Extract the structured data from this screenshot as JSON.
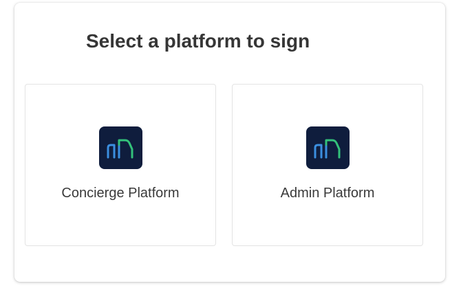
{
  "heading": "Select a platform to sign",
  "platforms": [
    {
      "label": "Concierge Platform",
      "icon": "building-logo-icon"
    },
    {
      "label": "Admin Platform",
      "icon": "building-logo-icon"
    }
  ],
  "colors": {
    "logo_background": "#0f1d3d",
    "logo_blue": "#3b8fe0",
    "logo_green": "#33c17a"
  }
}
